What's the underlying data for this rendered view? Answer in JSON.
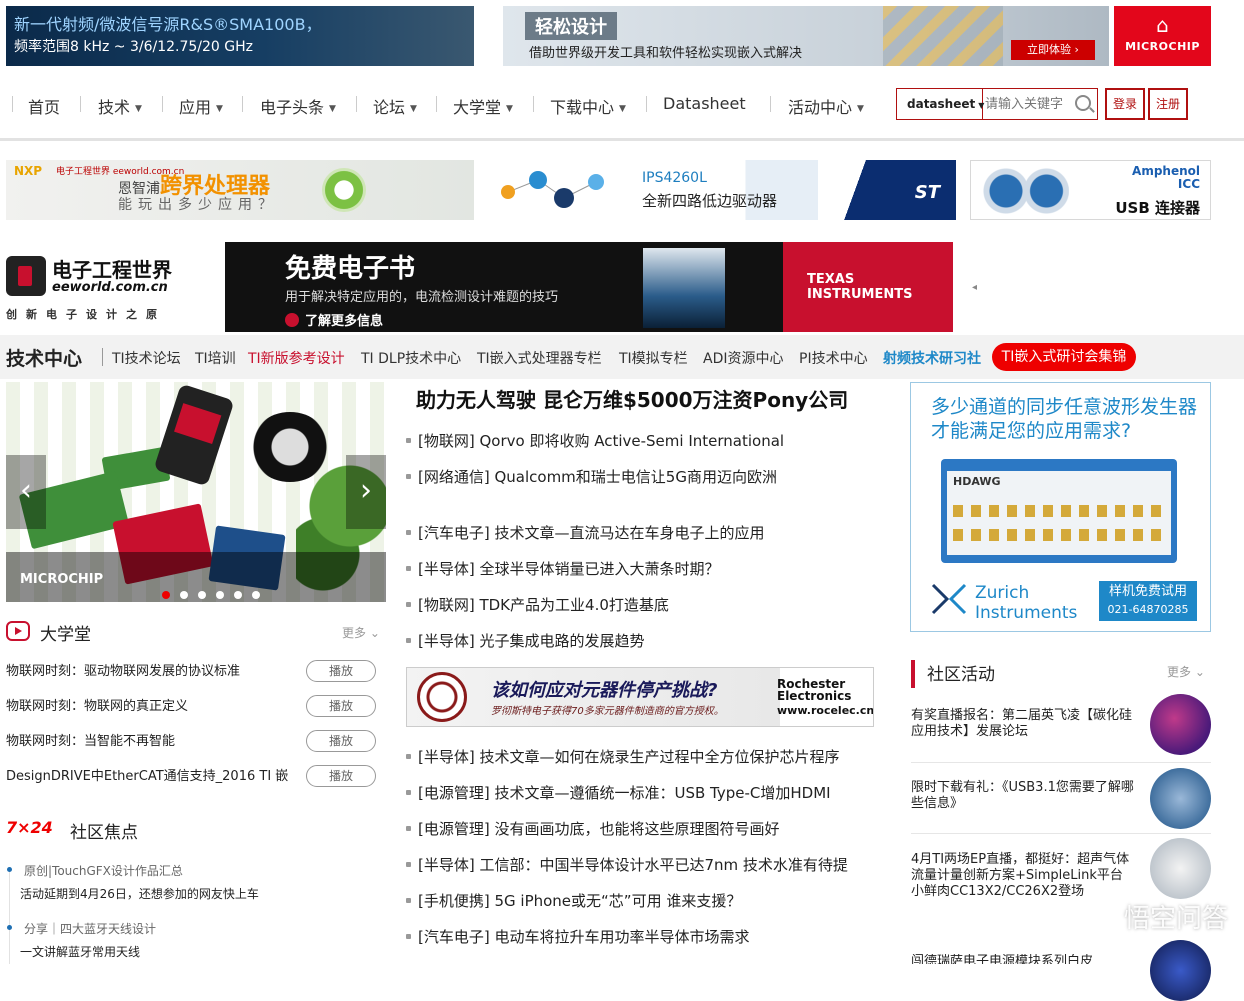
{
  "ads": {
    "rs_line1": "新一代射频/微波信号源R&S®SMA100B，",
    "rs_line2": "频率范围8 kHz ~ 3/6/12.75/20 GHz",
    "design_tag": "轻松设计",
    "design_sub": "借助世界级开发工具和软件轻松实现嵌入式解决",
    "design_btn": "立即体验 ›",
    "microchip": "MICROCHIP",
    "nxp": "NXP",
    "nxp_ee": "电子工程世界 eeworld.com.cn",
    "nxp_t1a": "恩智浦",
    "nxp_t1b": "跨界处理器",
    "nxp_t2": "能玩出多少应用？",
    "st_t1": "IPS4260L",
    "st_t2": "全新四路低边驱动器",
    "st_logo": "ST",
    "amph_1": "Amphenol",
    "amph_2": "ICC",
    "amph_3": "USB 连接器",
    "ti_h": "免费电子书",
    "ti_s": "用于解决特定应用的，电流检测设计难题的技巧",
    "ti_m": "了解更多信息",
    "ti_logo": "TEXAS INSTRUMENTS",
    "roc_l1": "该如何应对元器件停产挑战?",
    "roc_l2": "罗彻斯特电子获得70多家元器件制造商的官方授权。",
    "roc_r1": "Rochester Electronics",
    "roc_r2": "www.rocelec.cn",
    "zurich_q": "多少通道的同步任意波形发生器才能满足您的应用需求?",
    "zurich_dev": "HDAWG",
    "zurich_n1": "Zurich",
    "zurich_n2": "Instruments",
    "zurich_try": "样机免费试用",
    "zurich_phone": "021-64870285"
  },
  "nav": {
    "items": [
      {
        "label": "首页",
        "dropdown": false
      },
      {
        "label": "技术",
        "dropdown": true
      },
      {
        "label": "应用",
        "dropdown": true
      },
      {
        "label": "电子头条",
        "dropdown": true
      },
      {
        "label": "论坛",
        "dropdown": true
      },
      {
        "label": "大学堂",
        "dropdown": true
      },
      {
        "label": "下载中心",
        "dropdown": true
      },
      {
        "label": "Datasheet",
        "dropdown": false
      },
      {
        "label": "活动中心",
        "dropdown": true
      }
    ],
    "search_scope": "datasheet",
    "search_placeholder": "请输入关键字",
    "login": "登录",
    "register": "注册"
  },
  "logo": {
    "name": "电子工程世界",
    "domain": "eeworld.com.cn",
    "slogan": "创新电子设计之原"
  },
  "tech_center": {
    "title": "技术中心",
    "links": [
      {
        "label": "TI技术论坛",
        "style": "normal"
      },
      {
        "label": "TI培训",
        "style": "normal"
      },
      {
        "label": "TI新版参考设计",
        "style": "red"
      },
      {
        "label": "TI DLP技术中心",
        "style": "normal"
      },
      {
        "label": "TI嵌入式处理器专栏",
        "style": "normal"
      },
      {
        "label": "TI模拟专栏",
        "style": "normal"
      },
      {
        "label": "ADI资源中心",
        "style": "normal"
      },
      {
        "label": "PI技术中心",
        "style": "normal"
      },
      {
        "label": "射频技术研习社",
        "style": "blue"
      }
    ],
    "pill": "TI嵌入式研讨会集锦"
  },
  "carousel": {
    "brand": "MICROCHIP",
    "slides": 6,
    "active": 1
  },
  "university": {
    "title": "大学堂",
    "more": "更多",
    "play": "播放",
    "items": [
      "物联网时刻：驱动物联网发展的协议标准",
      "物联网时刻：物联网的真正定义",
      "物联网时刻：当智能不再智能",
      "DesignDRIVE中EtherCAT通信支持_2016 TI 嵌"
    ]
  },
  "focus": {
    "badge": "7×24",
    "title": "社区焦点",
    "items": [
      {
        "tag": "原创|TouchGFX设计作品汇总",
        "text": "活动延期到4月26日，还想参加的网友快上车"
      },
      {
        "tag": "分享｜四大蓝牙天线设计",
        "text": "一文讲解蓝牙常用天线"
      }
    ]
  },
  "news": {
    "headline": "助力无人驾驶 昆仑万维$5000万注资Pony公司",
    "group1": [
      "[物联网] Qorvo 即将收购 Active-Semi International",
      "[网络通信] Qualcomm和瑞士电信让5G商用迈向欧洲"
    ],
    "group2": [
      "[汽车电子] 技术文章—直流马达在车身电子上的应用",
      "[半导体] 全球半导体销量已进入大萧条时期？",
      "[物联网] TDK产品为工业4.0打造基底",
      "[半导体] 光子集成电路的发展趋势"
    ],
    "group3": [
      "[半导体] 技术文章—如何在烧录生产过程中全方位保护芯片程序",
      "[电源管理] 技术文章—遵循统一标准：USB Type-C增加HDMI",
      "[电源管理] 没有画画功底，也能将这些原理图符号画好",
      "[半导体] 工信部：中国半导体设计水平已达7nm 技术水准有待提",
      "[手机便携] 5G iPhone或无“芯”可用 谁来支援？",
      "[汽车电子] 电动车将拉升车用功率半导体市场需求"
    ]
  },
  "community": {
    "title": "社区活动",
    "more": "更多",
    "items": [
      "有奖直播报名：第二届英飞凌【碳化硅应用技术】发展论坛",
      "限时下载有礼：《USB3.1您需要了解哪些信息》",
      "4月TI两场EP直播，都挺好：超声气体流量计量创新方案+SimpleLink平台小鲜肉CC13X2/CC26X2登场",
      "闯德瑞萨电子电源模块系列白皮"
    ]
  },
  "watermark": "悟空问答",
  "colors": {
    "brand_red": "#c8102e",
    "link_blue": "#1e88c8",
    "ti_red": "#c8102e"
  }
}
